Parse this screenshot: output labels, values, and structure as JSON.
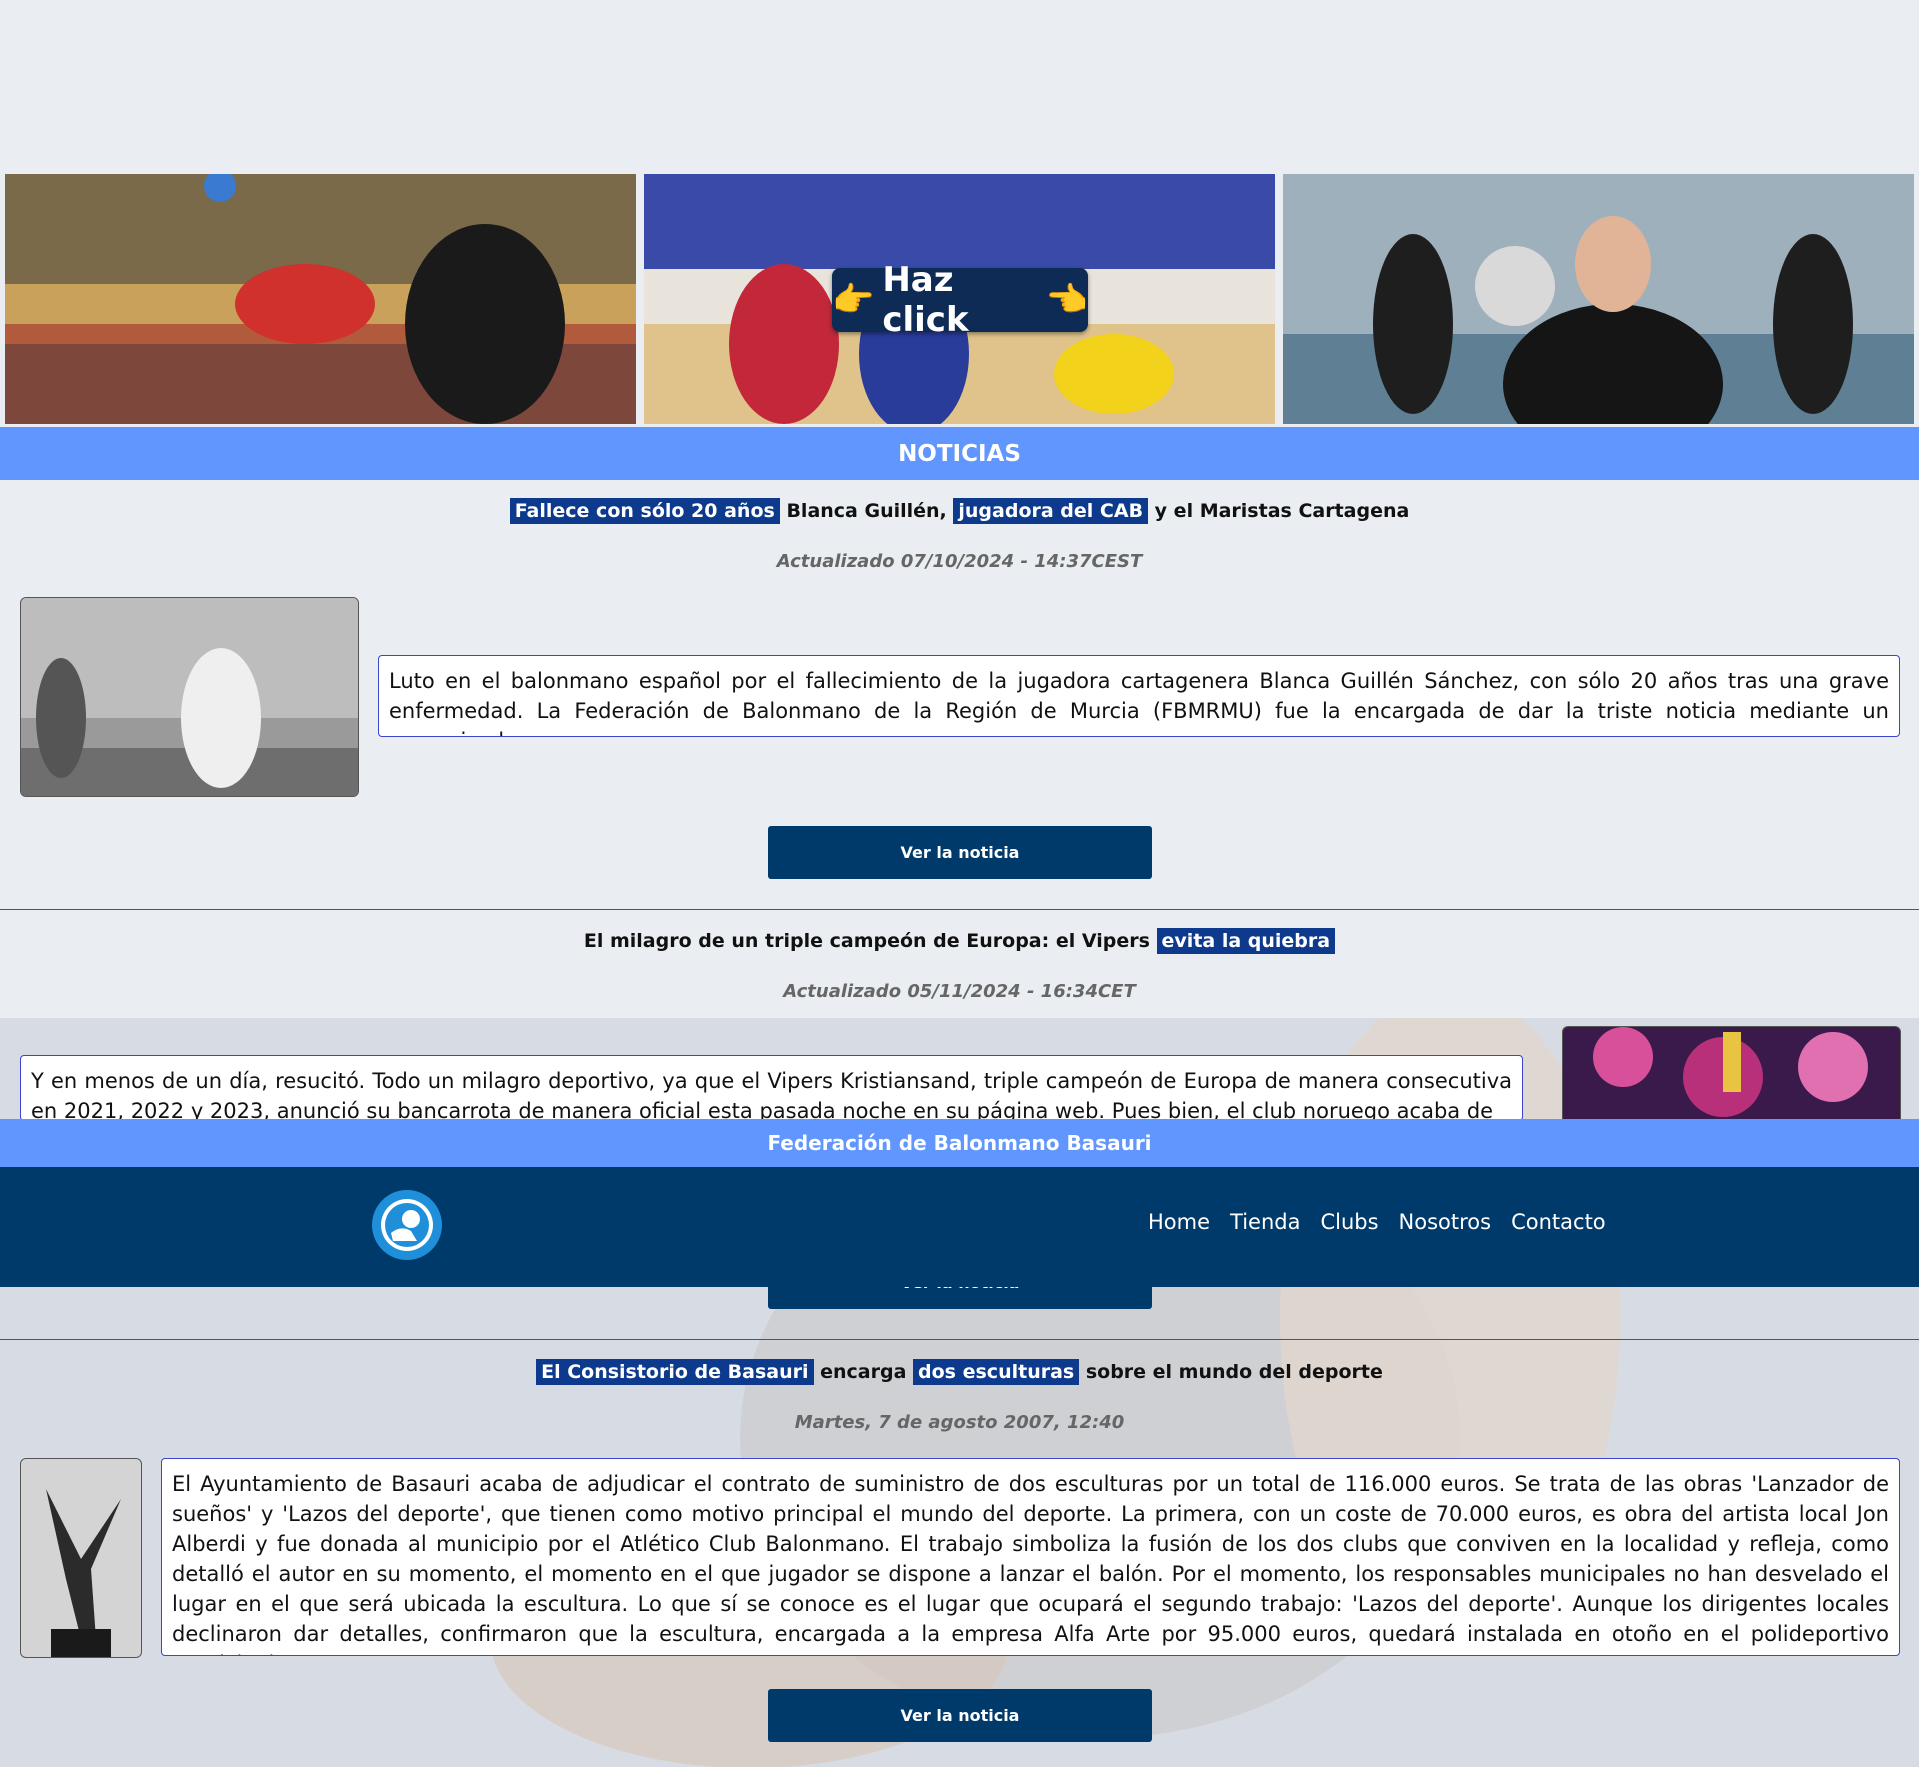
{
  "hero": {
    "cta_label": "Haz click",
    "cta_left_emoji": "👉",
    "cta_right_emoji": "👈"
  },
  "section_title": "NOTICIAS",
  "news": [
    {
      "title_parts": [
        {
          "text": "Fallece con sólo 20 años",
          "highlight": true
        },
        {
          "text": " Blanca Guillén, ",
          "highlight": false
        },
        {
          "text": "jugadora del CAB",
          "highlight": true
        },
        {
          "text": " y el Maristas Cartagena",
          "highlight": false
        }
      ],
      "date": "Actualizado 07/10/2024 - 14:37CEST",
      "body": "Luto en el balonmano español por el fallecimiento de la jugadora cartagenera Blanca Guillén Sánchez, con sólo 20 años tras una grave enfermedad. La Federación de Balonmano de la Región de Murcia (FBMRMU) fue la encargada de dar la triste noticia mediante un comunicado.",
      "button": "Ver la noticia"
    },
    {
      "title_parts": [
        {
          "text": "El milagro de un triple campeón de Europa: el Vipers ",
          "highlight": false
        },
        {
          "text": "evita la quiebra",
          "highlight": true
        }
      ],
      "date": "Actualizado 05/11/2024 - 16:34CET",
      "body": "Y en menos de un día, resucitó. Todo un milagro deportivo, ya que el Vipers Kristiansand, triple campeón de Europa de manera consecutiva en 2021, 2022 y 2023, anunció su bancarrota de manera oficial esta pasada noche en su página web. Pues bien, el club noruego acaba de",
      "button": "Ver la noticia"
    },
    {
      "title_parts": [
        {
          "text": "El Consistorio de Basauri",
          "highlight": true
        },
        {
          "text": " encarga ",
          "highlight": false
        },
        {
          "text": "dos esculturas",
          "highlight": true
        },
        {
          "text": " sobre el mundo del deporte",
          "highlight": false
        }
      ],
      "date": "Martes, 7 de agosto 2007, 12:40",
      "body": "El Ayuntamiento de Basauri acaba de adjudicar el contrato de suministro de dos esculturas por un total de 116.000 euros. Se trata de las obras 'Lanzador de sueños' y 'Lazos del deporte', que tienen como motivo principal el mundo del deporte. La primera, con un coste de 70.000 euros, es obra del artista local Jon Alberdi y fue donada al municipio por el Atlético Club Balonmano. El trabajo simboliza la fusión de los dos clubs que conviven en la localidad y refleja, como detalló el autor en su momento, el momento en el que jugador se dispone a lanzar el balón. Por el momento, los responsables municipales no han desvelado el lugar en el que será ubicada la escultura. Lo que sí se conoce es el lugar que ocupará el segundo trabajo: 'Lazos del deporte'. Aunque los dirigentes locales declinaron dar detalles, confirmaron que la escultura, encargada a la empresa Alfa Arte por 95.000 euros, quedará instalada en otoño en el polideportivo municipal.",
      "button": "Ver la noticia"
    }
  ],
  "header": {
    "federation_name": "Federación de Balonmano Basauri",
    "nav": [
      "Home",
      "Tienda",
      "Clubs",
      "Nosotros",
      "Contacto"
    ]
  },
  "colors": {
    "accent_bar": "#6096fd",
    "navy": "#003a6b",
    "highlight": "#0d3a8c",
    "page_bg": "#eaeef3"
  }
}
